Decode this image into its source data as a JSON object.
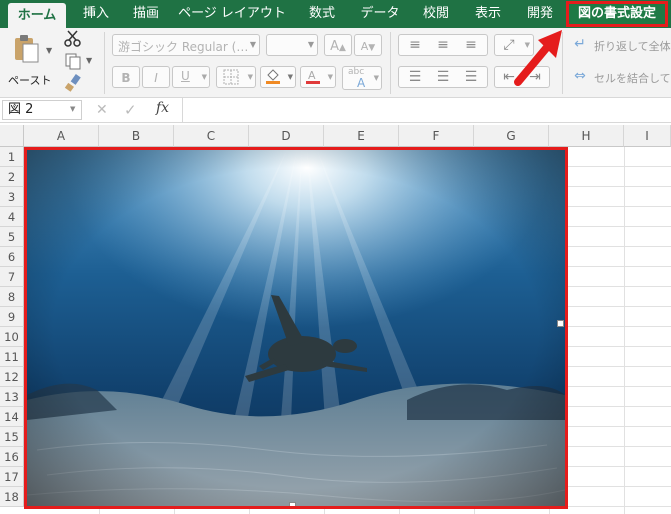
{
  "ribbon_tabs": [
    "ホーム",
    "挿入",
    "描画",
    "ページ レイアウト",
    "数式",
    "データ",
    "校閲",
    "表示",
    "開発",
    "図の書式設定"
  ],
  "clipboard": {
    "paste_label": "ペースト"
  },
  "font": {
    "name": "游ゴシック Regular (…",
    "size": ""
  },
  "format_buttons": {
    "bold": "B",
    "italic": "I",
    "underline": "U",
    "grow": "A",
    "shrink": "A",
    "phonetic_top": "abc",
    "phonetic_bottom": "A"
  },
  "alignment": {
    "wrap_text": "折り返して全体を",
    "merge_center": "セルを結合して中"
  },
  "formula_bar": {
    "name_box": "図 2",
    "fx": "fx",
    "cancel": "✕",
    "enter": "✓",
    "value": ""
  },
  "columns": [
    "A",
    "B",
    "C",
    "D",
    "E",
    "F",
    "G",
    "H",
    "I"
  ],
  "rows": [
    "1",
    "2",
    "3",
    "4",
    "5",
    "6",
    "7",
    "8",
    "9",
    "10",
    "11",
    "12",
    "13",
    "14",
    "15",
    "16",
    "17",
    "18"
  ],
  "colors": {
    "ribbon_green": "#1f7244",
    "highlight_red": "#e51c1c",
    "fill_orange": "#f08a24",
    "font_red": "#e03a3a"
  },
  "icons": {
    "paste": "clipboard-icon",
    "cut": "scissors-icon",
    "copy": "copy-icon",
    "format_painter": "brush-icon",
    "annotation": "red-arrow-icon"
  }
}
